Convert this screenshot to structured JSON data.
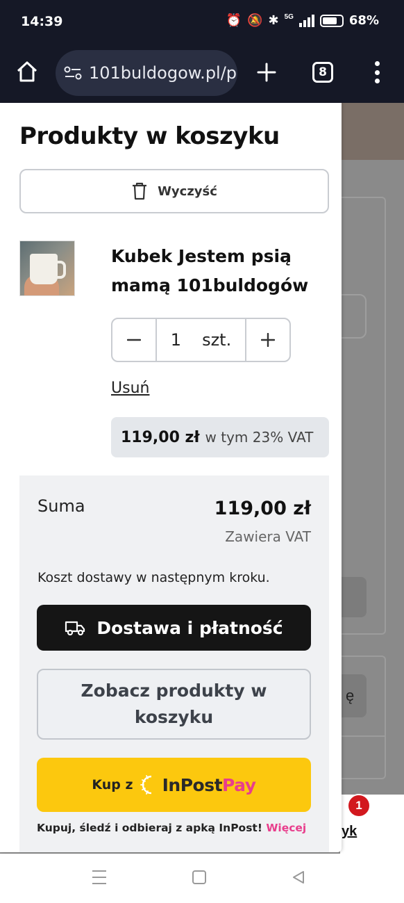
{
  "status_bar": {
    "time": "14:39",
    "network": "5G",
    "battery": "68%"
  },
  "browser": {
    "url": "101buldogow.pl/p",
    "tab_count": "8"
  },
  "background_page": {
    "partial_char": "ę",
    "partial_label": "yk",
    "badge_count": "1"
  },
  "cart": {
    "title": "Produkty w koszyku",
    "clear_label": "Wyczyść",
    "item": {
      "name": "Kubek Jestem psią mamą 101buldogów",
      "quantity": "1",
      "unit": "szt.",
      "remove_label": "Usuń",
      "price": "119,00 zł",
      "vat_note": "w tym 23% VAT"
    },
    "summary": {
      "label": "Suma",
      "value": "119,00 zł",
      "vat_note": "Zawiera VAT",
      "shipping_note": "Koszt dostawy w następnym kroku."
    },
    "checkout_label": "Dostawa i płatność",
    "view_cart_label": "Zobacz produkty w koszyku",
    "inpost": {
      "kup_label": "Kup z",
      "brand_inpost": "InPost",
      "brand_pay": "Pay",
      "note": "Kupuj, śledź i odbieraj z apką InPost!",
      "more_label": "Więcej"
    }
  },
  "colors": {
    "primary_button": "#151515",
    "inpost_yellow": "#fcc80e",
    "inpost_pink": "#e83e8c",
    "badge_red": "#d2181e"
  }
}
